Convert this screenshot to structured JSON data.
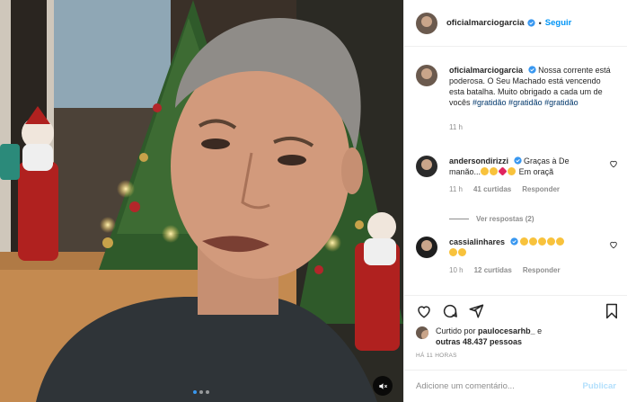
{
  "post": {
    "username": "oficialmarciogarcia",
    "follow_label": "Seguir",
    "separator": "•",
    "caption": "Nossa corrente está poderosa. O Seu Machado está vencendo esta batalha. Muito obrigado a cada um de vocês",
    "hashtags": "#gratidão #gratidão #gratidão",
    "caption_time": "11 h"
  },
  "comments": [
    {
      "username": "andersondirizzi",
      "text_start": "Graças à D",
      "text_cut": "e",
      "text_line2": "manão",
      "text_end": "Em oraçã",
      "time": "11 h",
      "likes": "41 curtidas",
      "reply_label": "Responder",
      "view_replies": "Ver respostas (2)"
    },
    {
      "username": "cassialinhares",
      "time": "10 h",
      "likes": "12 curtidas",
      "reply_label": "Responder"
    }
  ],
  "likes": {
    "prefix": "Curtido por",
    "user": "paulocesarhb_",
    "connector": "e",
    "others": "outras 48.437 pessoas"
  },
  "timestamp": "HÁ 11 HORAS",
  "comment_box": {
    "placeholder": "Adicione um comentário...",
    "publish_label": "Publicar"
  },
  "colors": {
    "accent": "#0095f6",
    "hashtag": "#00376b",
    "muted": "#8e8e8e",
    "verified": "#3897f0"
  },
  "icons": [
    "verified-badge-icon",
    "heart-icon",
    "comment-icon",
    "share-icon",
    "bookmark-icon",
    "mute-icon"
  ]
}
